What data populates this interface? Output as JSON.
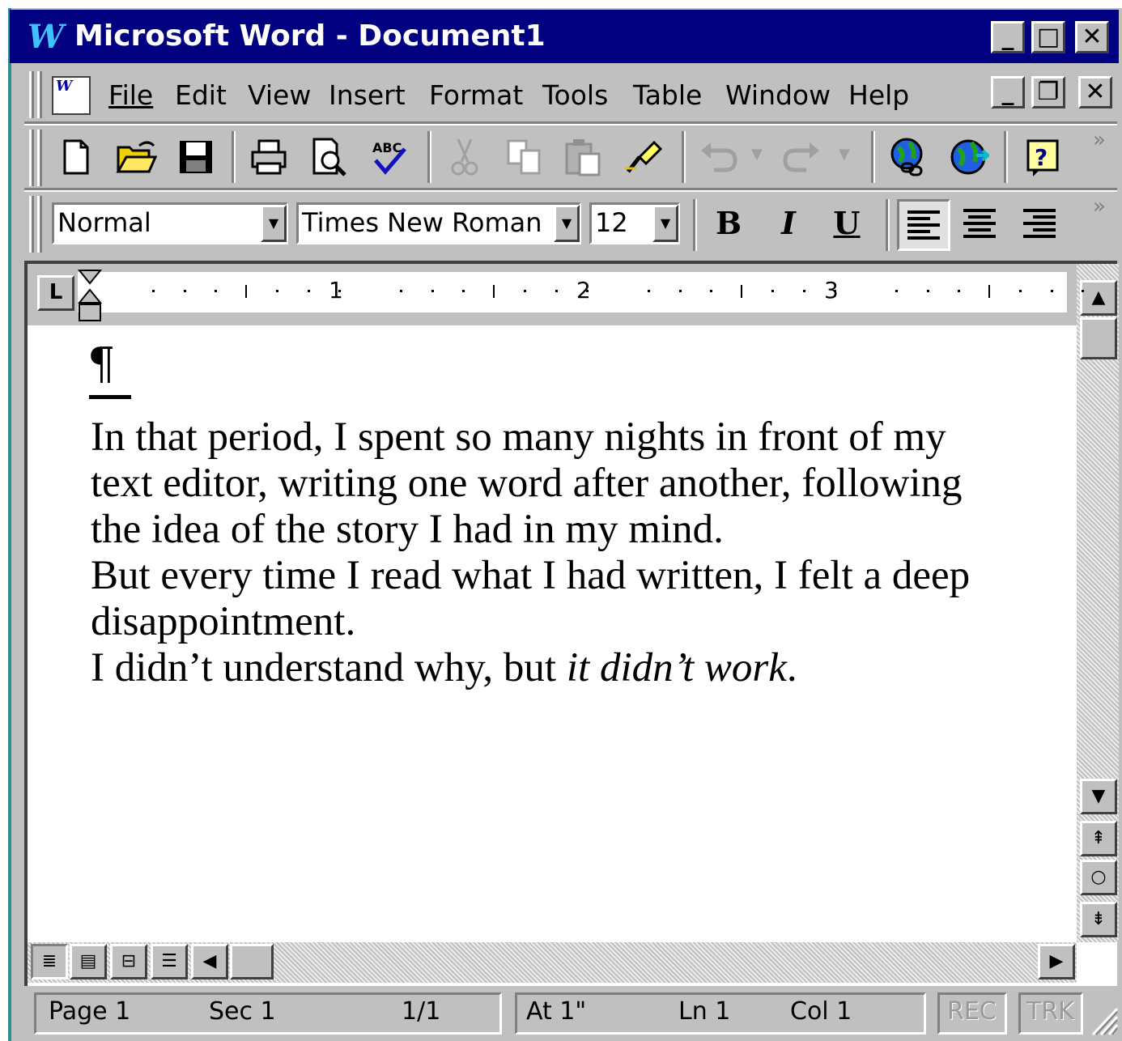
{
  "window": {
    "app_letter": "W",
    "title": "Microsoft Word - Document1",
    "minimize_glyph": "_",
    "maximize_glyph": "□",
    "close_glyph": "✕"
  },
  "menubar": {
    "items": [
      {
        "label": "File"
      },
      {
        "label": "Edit"
      },
      {
        "label": "View"
      },
      {
        "label": "Insert"
      },
      {
        "label": "Format"
      },
      {
        "label": "Tools"
      },
      {
        "label": "Table"
      },
      {
        "label": "Window"
      },
      {
        "label": "Help"
      }
    ],
    "doc_minimize_glyph": "_",
    "doc_restore_glyph": "❐",
    "doc_close_glyph": "✕"
  },
  "standard_toolbar": {
    "icons": [
      "new-document-icon",
      "open-folder-icon",
      "save-icon",
      "print-icon",
      "print-preview-icon",
      "spelling-icon",
      "cut-icon",
      "copy-icon",
      "paste-icon",
      "format-painter-icon",
      "undo-icon",
      "redo-icon",
      "insert-hyperlink-icon",
      "web-toolbar-icon",
      "help-icon"
    ],
    "more_glyph": "»"
  },
  "formatting_toolbar": {
    "style": "Normal",
    "font": "Times New Roman",
    "size": "12",
    "bold_label": "B",
    "italic_label": "I",
    "underline_label": "U",
    "more_glyph": "»"
  },
  "ruler": {
    "tab_selector": "L",
    "numbers": [
      "1",
      "2",
      "3"
    ]
  },
  "document": {
    "pilcrow": "¶",
    "lines": [
      "In that period, I spent so many nights in front of my",
      "text editor, writing one word after another, following",
      "the idea of the story I had in my mind.",
      "But every time I read what I had written, I felt a deep",
      "disappointment."
    ],
    "last_line_start": "I didn’t understand why, but ",
    "last_line_italic": "it didn’t work",
    "last_line_end": "."
  },
  "statusbar": {
    "page": "Page  1",
    "sec": "Sec  1",
    "page_of": "1/1",
    "at": "At  1\"",
    "ln": "Ln  1",
    "col": "Col  1",
    "rec": "REC",
    "trk": "TRK"
  }
}
